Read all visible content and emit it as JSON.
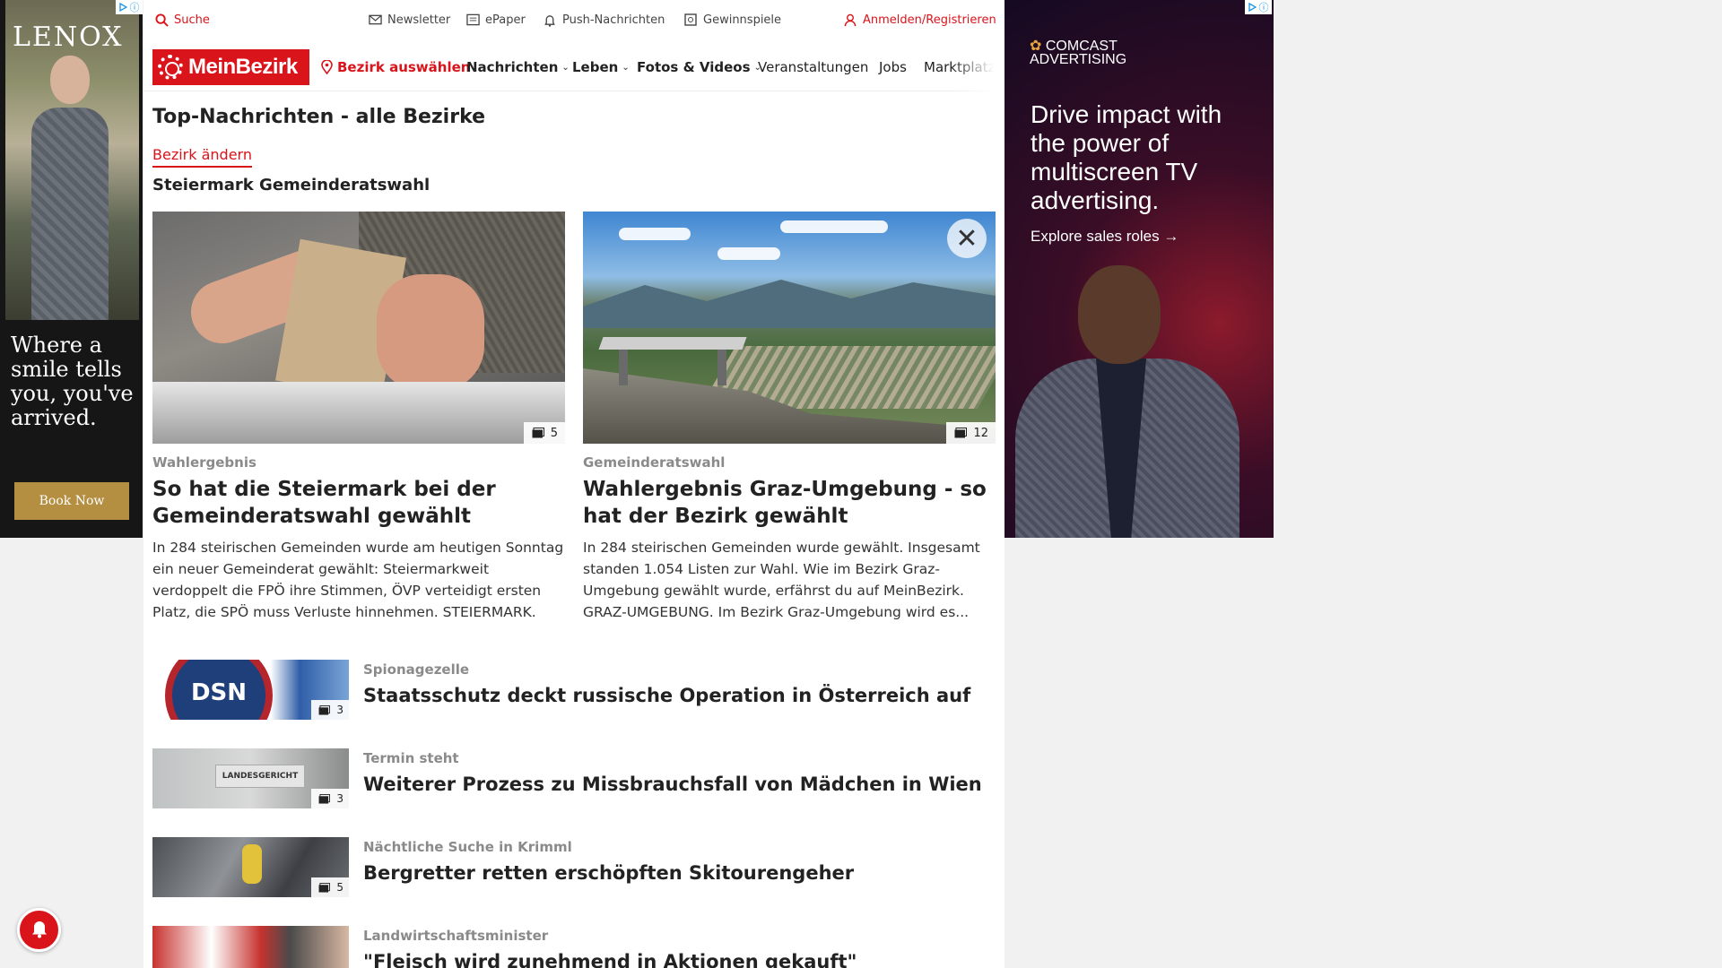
{
  "ad_left": {
    "brand": "LENOX",
    "tagline": "Where a smile tells you, you've arrived.",
    "button": "Book Now"
  },
  "topbar": {
    "search": "Suche",
    "newsletter": "Newsletter",
    "epaper": "ePaper",
    "push": "Push-Nachrichten",
    "gewinnspiele": "Gewinnspiele",
    "login": "Anmelden/Registrieren"
  },
  "nav": {
    "logo": "MeinBezirk",
    "bezirk": "Bezirk auswählen",
    "items": [
      "Nachrichten",
      "Leben",
      "Fotos & Videos",
      "Veranstaltungen",
      "Jobs",
      "Marktplatz"
    ]
  },
  "page": {
    "title": "Top-Nachrichten - alle Bezirke",
    "change_link": "Bezirk ändern",
    "section": "Steiermark Gemeinderatswahl"
  },
  "cards": [
    {
      "kicker": "Wahlergebnis",
      "title": "So hat die Steiermark bei der Gemeinderatswahl gewählt",
      "teaser": "In 284 steirischen Gemeinden wurde am heutigen Sonntag ein neuer Gemeinderat gewählt: Steiermarkweit verdoppelt die FPÖ ihre Stimmen, ÖVP verteidigt ersten Platz, die SPÖ muss Verluste hinnehmen.  STEIERMARK. Di...",
      "count": "5"
    },
    {
      "kicker": "Gemeinderatswahl",
      "title": "Wahlergebnis Graz-Umgebung - so hat der Bezirk gewählt",
      "teaser": "In 284 steirischen Gemeinden wurde gewählt. Insgesamt standen 1.054 Listen zur Wahl. Wie im Bezirk Graz-Umgebung gewählt wurde, erfährst du auf MeinBezirk. GRAZ-UMGEBUNG. Im Bezirk Graz-Umgebung wird es...",
      "count": "12"
    }
  ],
  "list": [
    {
      "kicker": "Spionagezelle",
      "title": "Staatsschutz deckt russische Operation in Österreich auf",
      "count": "3",
      "thumb_text": "DSN"
    },
    {
      "kicker": "Termin steht",
      "title": "Weiterer Prozess zu Missbrauchsfall von Mädchen in Wien",
      "count": "3",
      "thumb_text": "LANDESGERICHT"
    },
    {
      "kicker": "Nächtliche Suche in Krimml",
      "title": "Bergretter retten erschöpften Skitourengeher",
      "count": "5"
    },
    {
      "kicker": "Landwirtschaftsminister",
      "title": "\"Fleisch wird zunehmend in Aktionen gekauft\""
    }
  ],
  "ad_right": {
    "brand_line1": "COMCAST",
    "brand_line2": "ADVERTISING",
    "headline": "Drive impact with the power of multiscreen TV advertising.",
    "cta": "Explore sales roles"
  },
  "colors": {
    "accent": "#d9141b",
    "kicker": "#8a8a8a"
  },
  "icons": {
    "search": "search-icon",
    "newsletter": "mail-icon",
    "epaper": "newspaper-icon",
    "push": "bell-icon",
    "gewinnspiele": "gift-icon",
    "login": "user-icon",
    "bezirk": "location-pin-icon",
    "gallery": "gallery-icon"
  }
}
